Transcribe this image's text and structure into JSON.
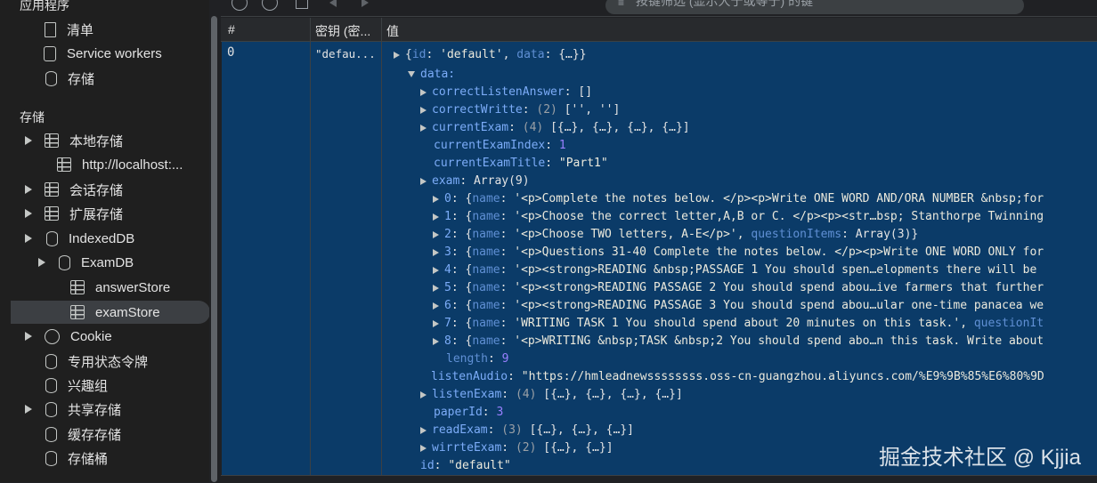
{
  "sidebar": {
    "app_heading": "应用程序",
    "app_items": [
      "清单",
      "Service workers",
      "存储"
    ],
    "storage_heading": "存储",
    "local_storage": "本地存储",
    "local_storage_origin": "http://localhost:...",
    "session_storage": "会话存储",
    "extension_storage": "扩展存储",
    "indexeddb": "IndexedDB",
    "examdb": "ExamDB",
    "answer_store": "answerStore",
    "exam_store": "examStore",
    "cookie": "Cookie",
    "private_state_tokens": "专用状态令牌",
    "interest_groups": "兴趣组",
    "shared_storage": "共享存储",
    "cache_storage": "缓存存储",
    "storage_buckets": "存储桶"
  },
  "toolbar": {
    "filter_placeholder": "按键筛选 (显示大于或等于) 的键"
  },
  "table": {
    "headers": {
      "num": "#",
      "key": "密钥 (密...",
      "value": "值"
    },
    "row": {
      "num": "0",
      "key": "\"defau..."
    }
  },
  "value": {
    "root_key_id": "id",
    "root_id_val": "'default'",
    "root_key_data": "data",
    "root_data_val": "{…}",
    "data_label": "data:",
    "correct_listen_key": "correctListenAnswer",
    "correct_listen_val": "[]",
    "correct_write_key": "correctWritte",
    "correct_write_count": "(2)",
    "correct_write_val": "['', '']",
    "current_exam_key": "currentExam",
    "current_exam_count": "(4)",
    "current_exam_val": "[{…}, {…}, {…}, {…}]",
    "current_exam_index_key": "currentExamIndex",
    "current_exam_index_val": "1",
    "current_exam_title_key": "currentExamTitle",
    "current_exam_title_val": "\"Part1\"",
    "exam_key": "exam",
    "exam_val": "Array(9)",
    "exam_items": [
      {
        "idx": "0",
        "text": "'<p>Complete the notes below. </p><p>Write ONE WORD AND/ORA NUMBER &nbsp;for"
      },
      {
        "idx": "1",
        "text": "'<p>Choose the correct letter,A,B or C. </p><p><str…bsp; Stanthorpe Twinning"
      },
      {
        "idx": "2",
        "text": "'<p>Choose TWO letters, A-E</p>', "
      },
      {
        "idx": "3",
        "text": "'<p>Questions 31-40 Complete the notes below. </p><p>Write ONE WORD ONLY for"
      },
      {
        "idx": "4",
        "text": "'<p><strong>READING &nbsp;PASSAGE 1 You should spen…elopments there will be"
      },
      {
        "idx": "5",
        "text": "'<p><strong>READING PASSAGE 2 You should spend abou…ive farmers that further"
      },
      {
        "idx": "6",
        "text": "'<p><strong>READING PASSAGE 3 You should spend abou…ular one-time panacea we"
      },
      {
        "idx": "7",
        "text": "'WRITING TASK 1 You should spend about 20 minutes on this task.', "
      },
      {
        "idx": "8",
        "text": "'<p>WRITING &nbsp;TASK &nbsp;2 You should spend abo…n this task. Write about"
      }
    ],
    "name_key": "name",
    "question_items_key": "questionItems",
    "question_items_val": "Array(3)}",
    "question_items_trunc": "questionIt",
    "length_key": "length",
    "length_val": "9",
    "listen_audio_key": "listenAudio",
    "listen_audio_val": "\"https://hmleadnewssssssss.oss-cn-guangzhou.aliyuncs.com/%E9%9B%85%E6%80%9D",
    "listen_exam_key": "listenExam",
    "listen_exam_count": "(4)",
    "listen_exam_val": "[{…}, {…}, {…}, {…}]",
    "paper_id_key": "paperId",
    "paper_id_val": "3",
    "read_exam_key": "readExam",
    "read_exam_count": "(3)",
    "read_exam_val": "[{…}, {…}, {…}]",
    "wirrte_exam_key": "wirrteExam",
    "wirrte_exam_count": "(2)",
    "wirrte_exam_val": "[{…}, {…}]",
    "id_key": "id",
    "id_val": "\"default\""
  },
  "watermark": "掘金技术社区 @ Kjjia"
}
